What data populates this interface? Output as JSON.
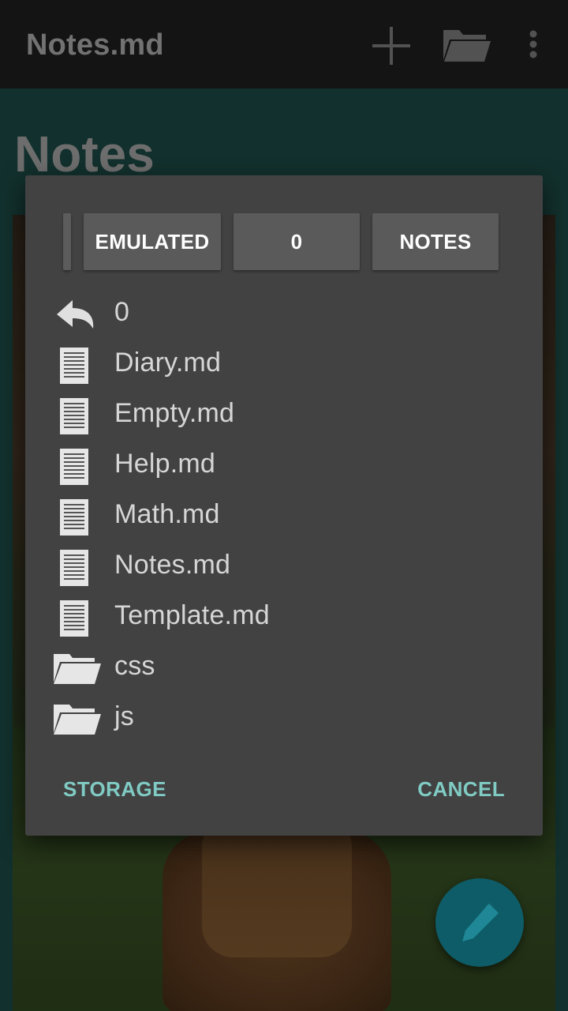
{
  "app_bar": {
    "title": "Notes.md",
    "icons": [
      "add-icon",
      "folder-icon",
      "more-vert-icon"
    ]
  },
  "page": {
    "heading": "Notes"
  },
  "dialog": {
    "breadcrumbs": [
      "EMULATED",
      "0",
      "NOTES"
    ],
    "entries": [
      {
        "label": "0",
        "icon": "back-arrow-icon",
        "type": "parent"
      },
      {
        "label": "Diary.md",
        "icon": "document-icon",
        "type": "file"
      },
      {
        "label": "Empty.md",
        "icon": "document-icon",
        "type": "file"
      },
      {
        "label": "Help.md",
        "icon": "document-icon",
        "type": "file"
      },
      {
        "label": "Math.md",
        "icon": "document-icon",
        "type": "file"
      },
      {
        "label": "Notes.md",
        "icon": "document-icon",
        "type": "file"
      },
      {
        "label": "Template.md",
        "icon": "document-icon",
        "type": "file"
      },
      {
        "label": "css",
        "icon": "folder-icon",
        "type": "folder"
      },
      {
        "label": "js",
        "icon": "folder-icon",
        "type": "folder"
      }
    ],
    "storage_label": "STORAGE",
    "cancel_label": "CANCEL"
  },
  "fab": {
    "icon": "pencil-icon"
  },
  "colors": {
    "app_bar": "#161616",
    "dialog_bg": "#424242",
    "accent": "#80cbc4",
    "fab": "#0e5c67"
  }
}
